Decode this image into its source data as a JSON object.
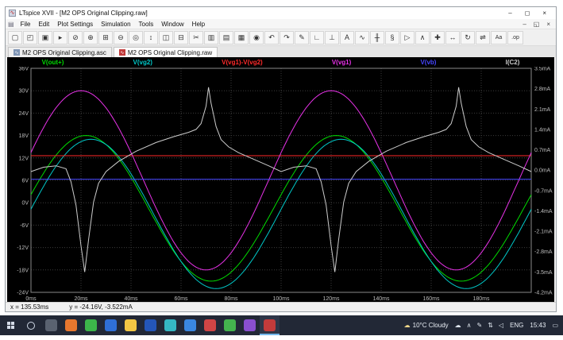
{
  "window": {
    "title": "LTspice XVII - [M2 OPS Original Clipping.raw]",
    "controls": {
      "minimize": "–",
      "restore": "◻",
      "close": "×"
    },
    "mdi_controls": {
      "minimize": "–",
      "restore": "◱",
      "close": "×"
    }
  },
  "menu": {
    "items": [
      "File",
      "Edit",
      "Plot Settings",
      "Simulation",
      "Tools",
      "Window",
      "Help"
    ]
  },
  "toolbar": {
    "buttons": [
      {
        "name": "new-schematic-button",
        "glyph": "▢"
      },
      {
        "name": "open-button",
        "glyph": "◰"
      },
      {
        "name": "save-button",
        "glyph": "▣"
      },
      {
        "name": "run-button",
        "glyph": "▸"
      },
      {
        "name": "halt-button",
        "glyph": "⊘"
      },
      {
        "name": "zoom-in-button",
        "glyph": "⊕"
      },
      {
        "name": "zoom-area-button",
        "glyph": "⊞"
      },
      {
        "name": "zoom-out-button",
        "glyph": "⊖"
      },
      {
        "name": "zoom-full-button",
        "glyph": "◎"
      },
      {
        "name": "autorange-button",
        "glyph": "↕"
      },
      {
        "name": "tile-vertical-button",
        "glyph": "◫"
      },
      {
        "name": "tile-horizontal-button",
        "glyph": "⊟"
      },
      {
        "name": "cut-button",
        "glyph": "✂"
      },
      {
        "name": "copy-button",
        "glyph": "▥"
      },
      {
        "name": "paste-button",
        "glyph": "▤"
      },
      {
        "name": "print-button",
        "glyph": "▦"
      },
      {
        "name": "find-button",
        "glyph": "◉"
      },
      {
        "name": "undo-button",
        "glyph": "↶"
      },
      {
        "name": "redo-button",
        "glyph": "↷"
      },
      {
        "name": "edit-button",
        "glyph": "✎"
      },
      {
        "name": "wire-button",
        "glyph": "∟"
      },
      {
        "name": "ground-button",
        "glyph": "⊥"
      },
      {
        "name": "label-net-button",
        "glyph": "A"
      },
      {
        "name": "resistor-button",
        "glyph": "∿"
      },
      {
        "name": "capacitor-button",
        "glyph": "╫"
      },
      {
        "name": "inductor-button",
        "glyph": "§"
      },
      {
        "name": "diode-button",
        "glyph": "▷"
      },
      {
        "name": "component-button",
        "glyph": "∧"
      },
      {
        "name": "move-button",
        "glyph": "✚"
      },
      {
        "name": "drag-button",
        "glyph": "↔"
      },
      {
        "name": "rotate-button",
        "glyph": "↻"
      },
      {
        "name": "mirror-button",
        "glyph": "⇌"
      },
      {
        "name": "text-button",
        "glyph": "Aa"
      },
      {
        "name": "spice-directive-button",
        "glyph": ".op"
      }
    ]
  },
  "tabs": [
    {
      "label": "M2 OPS Original Clipping.asc",
      "active": false
    },
    {
      "label": "M2 OPS Original Clipping.raw",
      "active": true
    }
  ],
  "status": {
    "x_readout": "x = 135.53ms",
    "y_readout": "y = -24.16V, -3.522mA"
  },
  "taskbar": {
    "weather": {
      "glyph": "☁",
      "text": "10°C Cloudy"
    },
    "apps": [
      {
        "name": "taskbar-app-1",
        "color": "#5a6270",
        "active": false
      },
      {
        "name": "taskbar-app-2",
        "color": "#e8772e",
        "active": false
      },
      {
        "name": "taskbar-app-3",
        "color": "#3cb54a",
        "active": false
      },
      {
        "name": "taskbar-app-4",
        "color": "#2f6fd6",
        "active": false
      },
      {
        "name": "taskbar-app-explorer",
        "color": "#f3c744",
        "active": false
      },
      {
        "name": "taskbar-app-6",
        "color": "#2456b8",
        "active": false
      },
      {
        "name": "taskbar-app-7",
        "color": "#35b8c4",
        "active": false
      },
      {
        "name": "taskbar-app-8",
        "color": "#3a87e0",
        "active": false
      },
      {
        "name": "taskbar-app-9",
        "color": "#d04545",
        "active": false
      },
      {
        "name": "taskbar-app-10",
        "color": "#44b44e",
        "active": false
      },
      {
        "name": "taskbar-app-11",
        "color": "#8a4fd0",
        "active": false
      },
      {
        "name": "taskbar-app-ltspice",
        "color": "#c23b3b",
        "active": true
      }
    ],
    "tray_icons": [
      {
        "name": "onedrive-icon",
        "glyph": "☁"
      },
      {
        "name": "hidden-icons-chevron",
        "glyph": "∧"
      },
      {
        "name": "pen-icon",
        "glyph": "✎"
      },
      {
        "name": "network-icon",
        "glyph": "⇅"
      },
      {
        "name": "volume-icon",
        "glyph": "◁"
      }
    ],
    "language": "ENG",
    "time": "15:43",
    "notification_glyph": "▭"
  },
  "chart_data": {
    "type": "line",
    "title": "",
    "background": "#000000",
    "grid": true,
    "x": {
      "unit": "ms",
      "min": 0,
      "max": 200,
      "tick_step": 20,
      "tick_labels": [
        "0ms",
        "20ms",
        "40ms",
        "60ms",
        "80ms",
        "100ms",
        "120ms",
        "140ms",
        "160ms",
        "180ms"
      ]
    },
    "y_left": {
      "unit": "V",
      "min": -24,
      "max": 36,
      "tick_step": 6,
      "tick_labels": [
        "36V",
        "30V",
        "24V",
        "18V",
        "12V",
        "6V",
        "0V",
        "-6V",
        "-12V",
        "-18V",
        "-24V"
      ]
    },
    "y_right": {
      "unit": "mA",
      "min": -4.2,
      "max": 3.5,
      "tick_step": 0.7,
      "tick_labels": [
        "3.5mA",
        "2.8mA",
        "2.1mA",
        "1.4mA",
        "0.7mA",
        "0.0mA",
        "-0.7mA",
        "-1.4mA",
        "-2.1mA",
        "-2.8mA",
        "-3.5mA",
        "-4.2mA"
      ]
    },
    "series": [
      {
        "name": "V(out+)",
        "color": "#00dc00",
        "axis": "left",
        "model": "sine",
        "offset": -1.5,
        "amplitude": 19.5,
        "period_ms": 100,
        "peak_at_ms": 22
      },
      {
        "name": "V(vg2)",
        "color": "#00c8c8",
        "axis": "left",
        "model": "sine",
        "offset": -3,
        "amplitude": 20,
        "period_ms": 100,
        "peak_at_ms": 24
      },
      {
        "name": "V(vg1)-V(vg2)",
        "color": "#ff2a2a",
        "axis": "left",
        "model": "const",
        "value": 12.6
      },
      {
        "name": "V(vg1)",
        "color": "#e832e8",
        "axis": "left",
        "model": "sine",
        "offset": 6,
        "amplitude": 24,
        "period_ms": 100,
        "peak_at_ms": 20
      },
      {
        "name": "V(vb)",
        "color": "#4646ff",
        "axis": "left",
        "model": "const",
        "value": 6.3
      },
      {
        "name": "I(C2)",
        "color": "#cccccc",
        "axis": "right",
        "model": "points",
        "points": [
          [
            0,
            -0.05
          ],
          [
            5,
            0.1
          ],
          [
            10,
            0.15
          ],
          [
            14,
            0.05
          ],
          [
            16,
            -0.4
          ],
          [
            18,
            -1.2
          ],
          [
            20,
            -2.6
          ],
          [
            21.5,
            -3.5
          ],
          [
            23,
            -2.4
          ],
          [
            25,
            -1.1
          ],
          [
            27,
            -0.45
          ],
          [
            30,
            -0.05
          ],
          [
            35,
            0.3
          ],
          [
            42,
            0.65
          ],
          [
            50,
            0.95
          ],
          [
            57,
            1.15
          ],
          [
            63,
            1.3
          ],
          [
            66,
            1.4
          ],
          [
            68,
            1.6
          ],
          [
            70,
            2.2
          ],
          [
            71,
            2.85
          ],
          [
            72,
            2.3
          ],
          [
            74,
            1.5
          ],
          [
            76,
            1.05
          ],
          [
            79,
            0.8
          ],
          [
            83,
            0.6
          ],
          [
            87,
            0.45
          ],
          [
            91,
            0.3
          ],
          [
            95,
            0.15
          ],
          [
            100,
            -0.05
          ],
          [
            105,
            0.1
          ],
          [
            110,
            0.15
          ],
          [
            114,
            0.05
          ],
          [
            116,
            -0.4
          ],
          [
            118,
            -1.2
          ],
          [
            120,
            -2.6
          ],
          [
            121.5,
            -3.5
          ],
          [
            123,
            -2.4
          ],
          [
            125,
            -1.1
          ],
          [
            127,
            -0.45
          ],
          [
            130,
            -0.05
          ],
          [
            135,
            0.3
          ],
          [
            142,
            0.65
          ],
          [
            150,
            0.95
          ],
          [
            157,
            1.15
          ],
          [
            163,
            1.3
          ],
          [
            166,
            1.4
          ],
          [
            168,
            1.6
          ],
          [
            170,
            2.2
          ],
          [
            171,
            2.85
          ],
          [
            172,
            2.3
          ],
          [
            174,
            1.5
          ],
          [
            176,
            1.05
          ],
          [
            179,
            0.8
          ],
          [
            183,
            0.6
          ],
          [
            187,
            0.45
          ],
          [
            191,
            0.3
          ],
          [
            195,
            0.15
          ],
          [
            200,
            -0.05
          ]
        ]
      }
    ]
  }
}
